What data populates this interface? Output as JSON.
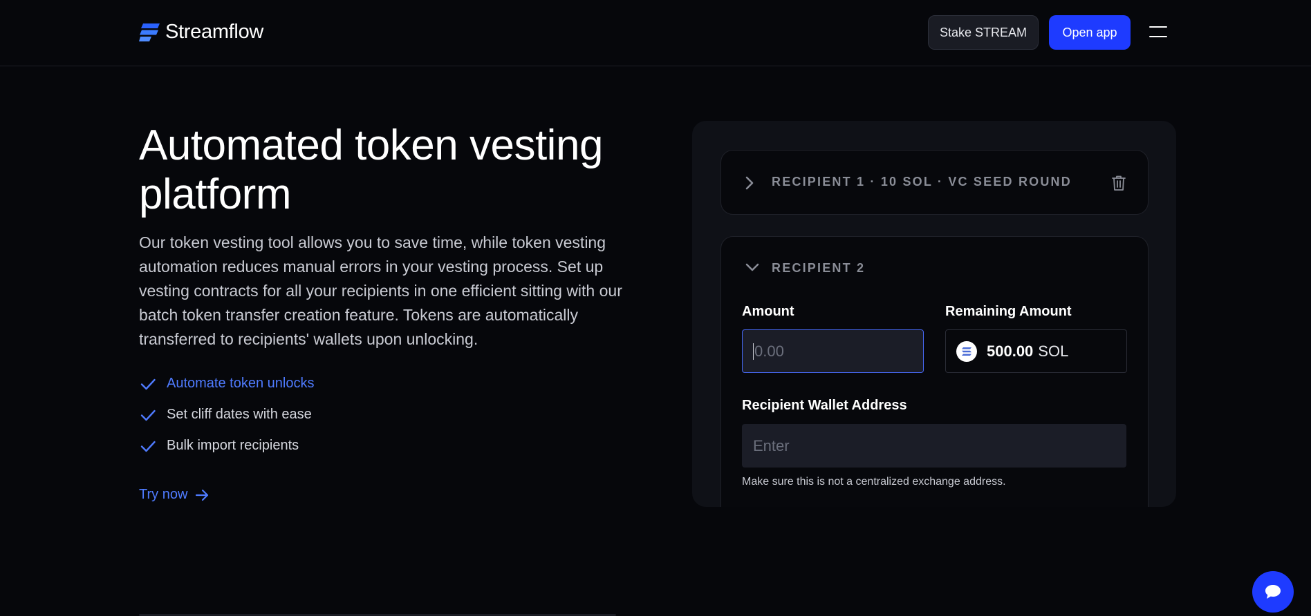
{
  "header": {
    "brand": "Streamflow",
    "stake_label": "Stake STREAM",
    "open_app_label": "Open app",
    "icons": {
      "logo": "streamflow-logo-icon",
      "menu": "hamburger-menu-icon"
    },
    "colors": {
      "primary": "#1e3bff",
      "background": "#06070b"
    }
  },
  "hero": {
    "title": "Automated token vesting platform",
    "description": "Our token vesting tool allows you to save time, while token vesting automation reduces manual errors in your vesting process. Set up vesting contracts for all your recipients in one efficient sitting with our batch token transfer creation feature. Tokens are automatically transferred to recipients' wallets upon unlocking.",
    "features": [
      {
        "label": "Automate token unlocks",
        "active": true
      },
      {
        "label": "Set cliff dates with ease",
        "active": false
      },
      {
        "label": "Bulk import recipients",
        "active": false
      }
    ],
    "cta_label": "Try now",
    "accent_color": "#4f7bff"
  },
  "card": {
    "recipient1": {
      "label": "RECIPIENT 1 · 10 SOL · VC SEED ROUND",
      "icons": [
        "chevron-right-icon",
        "trash-icon"
      ]
    },
    "recipient2": {
      "label": "RECIPIENT 2",
      "amount_label": "Amount",
      "amount_placeholder": "0.00",
      "remaining_label": "Remaining Amount",
      "remaining_value": "500.00",
      "remaining_unit": "SOL",
      "wallet_label": "Recipient Wallet Address",
      "wallet_placeholder": "Enter",
      "hint": "Make sure this is not a centralized exchange address."
    }
  },
  "chat": {
    "icon": "chat-bubble-icon"
  }
}
